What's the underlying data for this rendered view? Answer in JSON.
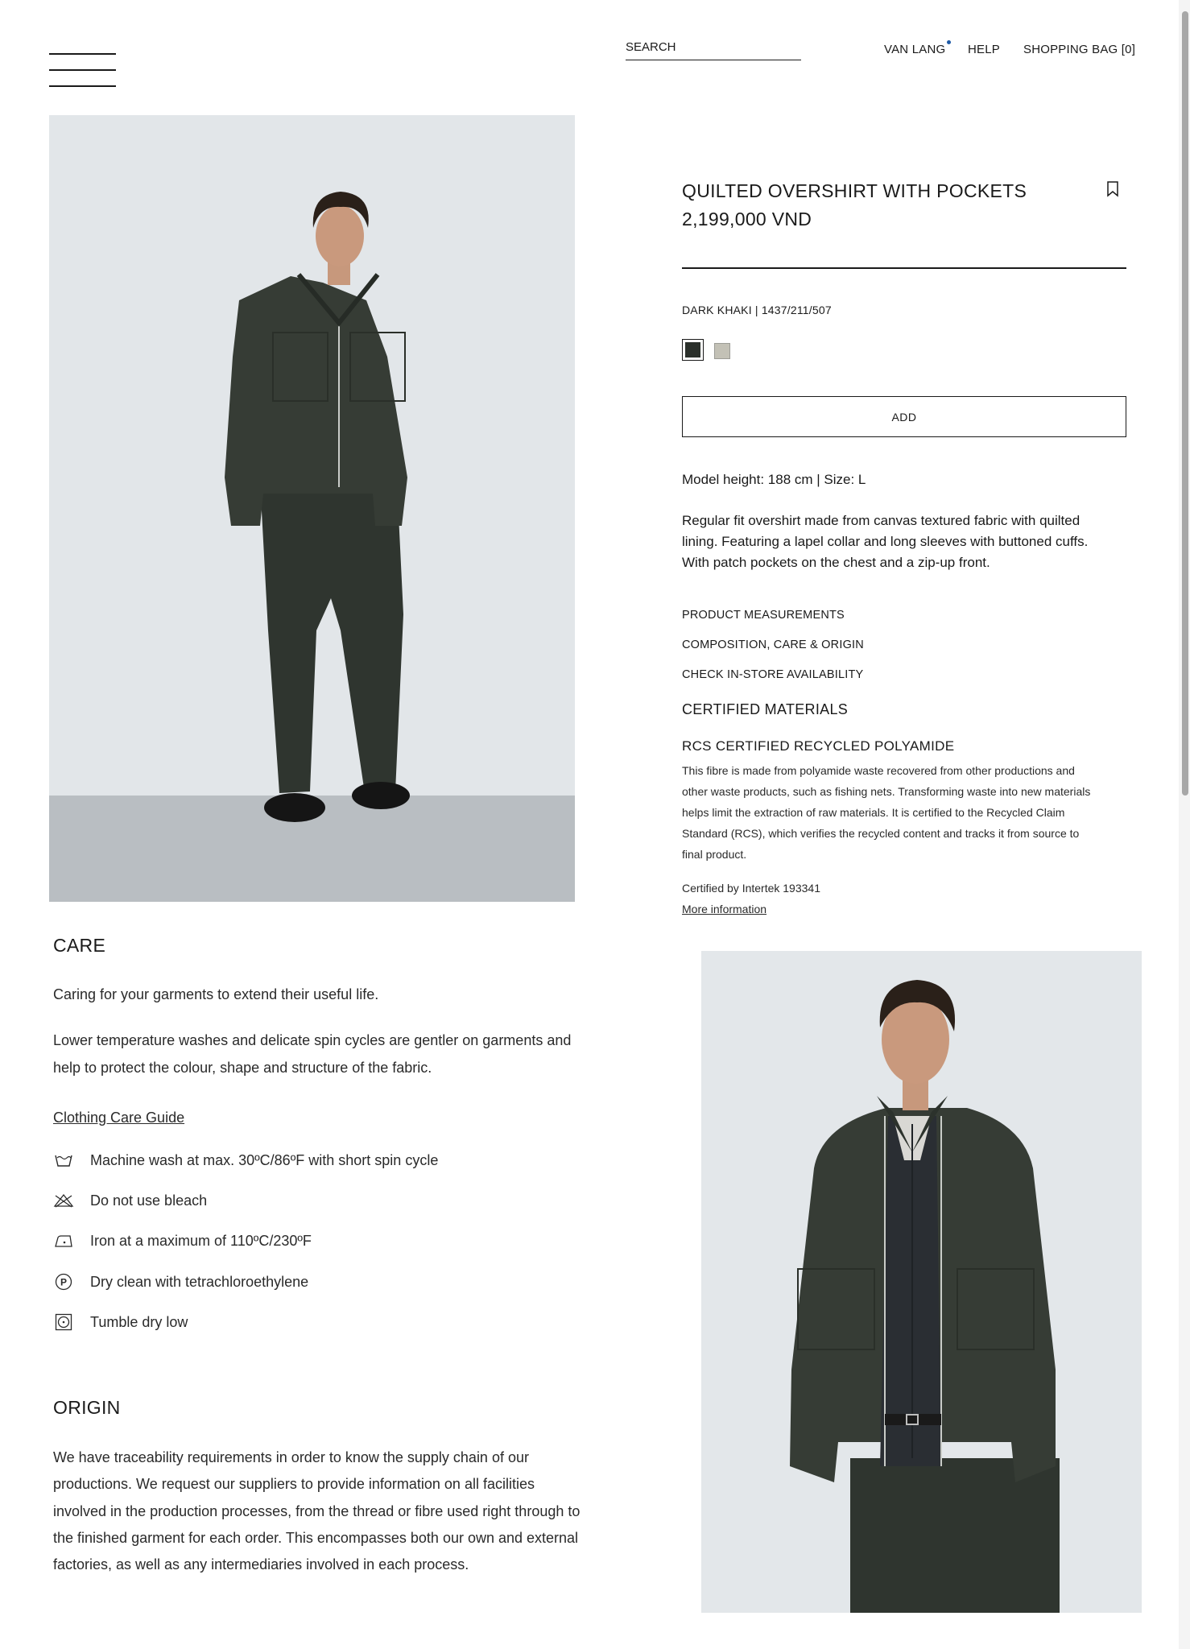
{
  "header": {
    "search_placeholder": "SEARCH",
    "account": "VAN LANG",
    "help": "HELP",
    "bag": "SHOPPING BAG [0]"
  },
  "product": {
    "title": "QUILTED OVERSHIRT WITH POCKETS",
    "price": "2,199,000 VND",
    "color_ref": "DARK KHAKI | 1437/211/507",
    "swatches": [
      {
        "name": "Dark khaki",
        "color": "#2b302b",
        "selected": true
      },
      {
        "name": "Light",
        "color": "#c3c1b6",
        "selected": false
      }
    ],
    "add_label": "ADD",
    "model_info": "Model height: 188 cm | Size: L",
    "description": "Regular fit overshirt made from canvas textured fabric with quilted lining. Featuring a lapel collar and long sleeves with buttoned cuffs. With patch pockets on the chest and a zip-up front.",
    "links": [
      "PRODUCT MEASUREMENTS",
      "COMPOSITION, CARE & ORIGIN",
      "CHECK IN-STORE AVAILABILITY"
    ],
    "certified_heading": "CERTIFIED MATERIALS",
    "rcs_heading": "RCS CERTIFIED RECYCLED POLYAMIDE",
    "rcs_text": "This fibre is made from polyamide waste recovered from other productions and other waste products, such as fishing nets. Transforming waste into new materials helps limit the extraction of raw materials. It is certified to the Recycled Claim Standard (RCS), which verifies the recycled content and tracks it from source to final product.",
    "certified_by": "Certified by Intertek 193341",
    "more_info": "More information"
  },
  "care": {
    "heading": "CARE",
    "intro": "Caring for your garments to extend their useful life.",
    "text": "Lower temperature washes and delicate spin cycles are gentler on garments and help to protect the colour, shape and structure of the fabric.",
    "guide_link": "Clothing Care Guide",
    "instructions": [
      {
        "icon": "wash-tub-icon",
        "text": "Machine wash at max. 30ºC/86ºF with short spin cycle"
      },
      {
        "icon": "no-bleach-icon",
        "text": "Do not use bleach"
      },
      {
        "icon": "iron-icon",
        "text": "Iron at a maximum of 110ºC/230ºF"
      },
      {
        "icon": "dry-clean-p-icon",
        "text": "Dry clean with tetrachloroethylene"
      },
      {
        "icon": "tumble-dry-low-icon",
        "text": "Tumble dry low"
      }
    ]
  },
  "origin": {
    "heading": "ORIGIN",
    "text": "We have traceability requirements in order to know the supply chain of our productions. We request our suppliers to provide information on all facilities involved in the production processes, from the thread or fibre used right through to the finished garment for each order. This encompasses both our own and external factories, as well as any intermediaries involved in each process."
  },
  "colors": {
    "text": "#1a1a1a",
    "accent_dot": "#1f5ba7",
    "photo_background": "#e2e6e9",
    "garment": "#343a33"
  }
}
